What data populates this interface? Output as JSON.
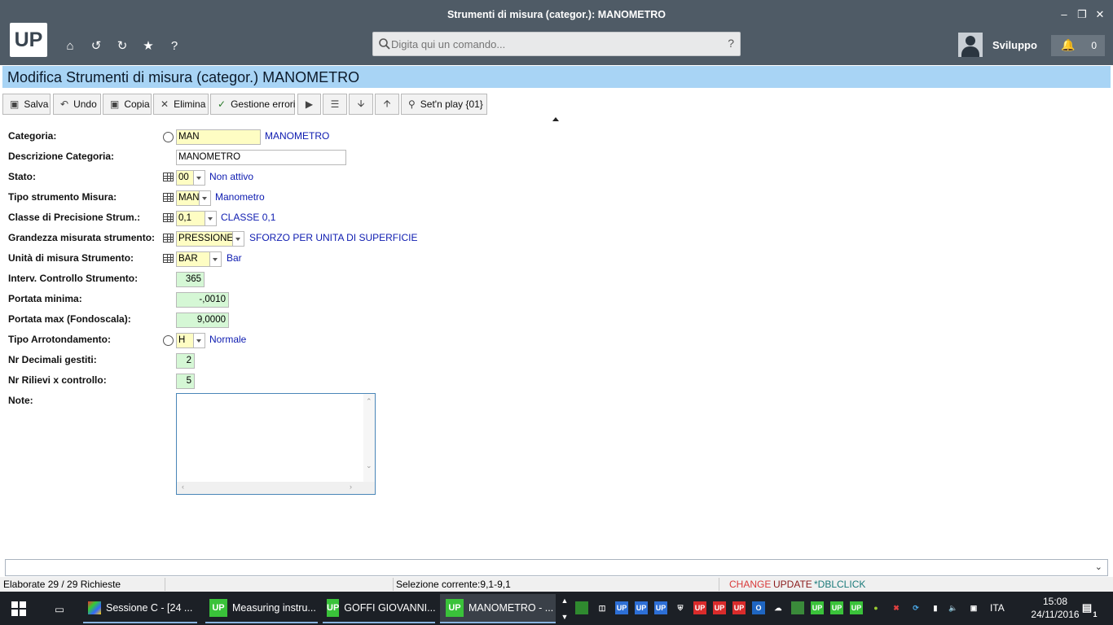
{
  "window": {
    "title": "Strumenti di misura (categor.): MANOMETRO"
  },
  "appbar": {
    "logo": "UP",
    "command_placeholder": "Digita qui un comando...",
    "help": "?",
    "username": "Sviluppo",
    "notifications": "0"
  },
  "heading": "Modifica Strumenti di misura (categor.) MANOMETRO",
  "toolbar": {
    "save": "Salva",
    "undo": "Undo",
    "copy": "Copia",
    "delete": "Elimina",
    "errors": "Gestione errori",
    "setnplay": "Set'n play {01}"
  },
  "form": {
    "categoria": {
      "label": "Categoria:",
      "value": "MAN",
      "desc": "MANOMETRO"
    },
    "descrizione": {
      "label": "Descrizione Categoria:",
      "value": "MANOMETRO"
    },
    "stato": {
      "label": "Stato:",
      "value": "00",
      "desc": "Non attivo"
    },
    "tipo": {
      "label": "Tipo strumento Misura:",
      "value": "MAN",
      "desc": "Manometro"
    },
    "classe": {
      "label": "Classe di Precisione Strum.:",
      "value": "0,1",
      "desc": "CLASSE 0,1"
    },
    "grandezza": {
      "label": "Grandezza misurata strumento:",
      "value": "PRESSIONE",
      "desc": "SFORZO PER UNITA DI SUPERFICIE"
    },
    "unita": {
      "label": "Unità di misura Strumento:",
      "value": "BAR",
      "desc": "Bar"
    },
    "interv": {
      "label": "Interv. Controllo Strumento:",
      "value": "365"
    },
    "portata_min": {
      "label": "Portata minima:",
      "value": "-,0010"
    },
    "portata_max": {
      "label": "Portata max (Fondoscala):",
      "value": "9,0000"
    },
    "arrotondamento": {
      "label": "Tipo Arrotondamento:",
      "value": "H",
      "desc": "Normale"
    },
    "decimali": {
      "label": "Nr Decimali gestiti:",
      "value": "2"
    },
    "rilievi": {
      "label": "Nr Rilievi x controllo:",
      "value": "5"
    },
    "note": {
      "label": "Note:",
      "value": ""
    }
  },
  "status": {
    "elaborate": "Elaborate 29 / 29 Richieste",
    "selezione": "Selezione corrente:9,1-9,1",
    "change": "CHANGE",
    "update": "UPDATE",
    "dblclick": "*DBLCLICK",
    "colors": {
      "change": "#d93a3a",
      "update": "#8a1a1a",
      "dblclick": "#1a7a7a"
    }
  },
  "taskbar": {
    "tasks": [
      "Sessione C - [24 ...",
      "Measuring instru...",
      "GOFFI GIOVANNI...",
      "MANOMETRO - ..."
    ],
    "lang": "ITA",
    "time": "15:08",
    "date": "24/11/2016",
    "notif_count": "1"
  }
}
